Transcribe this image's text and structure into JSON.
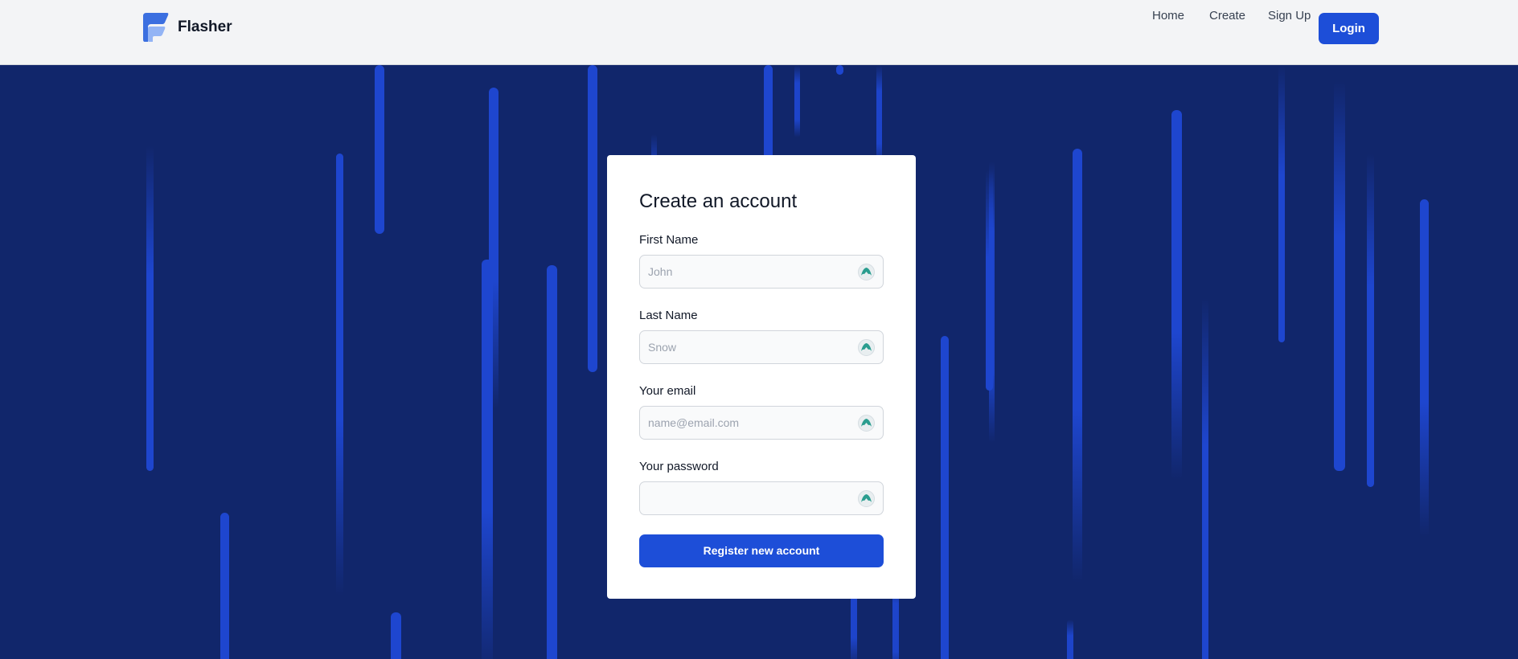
{
  "header": {
    "brand_name": "Flasher",
    "nav": {
      "home": "Home",
      "create": "Create",
      "signup": "Sign Up",
      "login": "Login"
    }
  },
  "form": {
    "title": "Create an account",
    "first_name": {
      "label": "First Name",
      "placeholder": "John",
      "value": ""
    },
    "last_name": {
      "label": "Last Name",
      "placeholder": "Snow",
      "value": ""
    },
    "email": {
      "label": "Your email",
      "placeholder": "name@email.com",
      "value": ""
    },
    "password": {
      "label": "Your password",
      "placeholder": "",
      "value": ""
    },
    "submit_label": "Register new account",
    "field_icon": "password-manager-icon"
  },
  "colors": {
    "accent": "#1d4ed8",
    "background": "#11266b",
    "streak": "#1e46cf",
    "field_icon": "#2a9d8f"
  }
}
